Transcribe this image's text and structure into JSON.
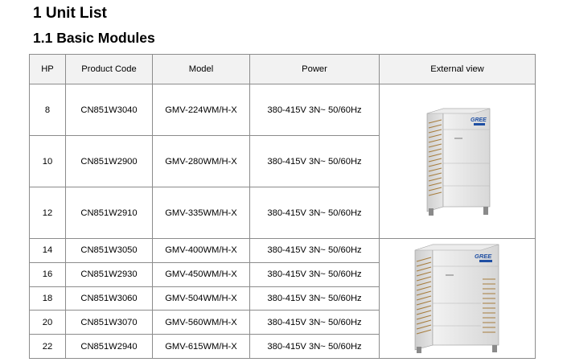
{
  "headings": {
    "h1": "1 Unit List",
    "h2": "1.1 Basic Modules"
  },
  "table": {
    "columns": [
      "HP",
      "Product Code",
      "Model",
      "Power",
      "External view"
    ],
    "rows": [
      {
        "hp": "8",
        "code": "CN851W3040",
        "model": "GMV-224WM/H-X",
        "power": "380-415V 3N~ 50/60Hz"
      },
      {
        "hp": "10",
        "code": "CN851W2900",
        "model": "GMV-280WM/H-X",
        "power": "380-415V 3N~ 50/60Hz"
      },
      {
        "hp": "12",
        "code": "CN851W2910",
        "model": "GMV-335WM/H-X",
        "power": "380-415V 3N~ 50/60Hz"
      },
      {
        "hp": "14",
        "code": "CN851W3050",
        "model": "GMV-400WM/H-X",
        "power": "380-415V 3N~ 50/60Hz"
      },
      {
        "hp": "16",
        "code": "CN851W2930",
        "model": "GMV-450WM/H-X",
        "power": "380-415V 3N~ 50/60Hz"
      },
      {
        "hp": "18",
        "code": "CN851W3060",
        "model": "GMV-504WM/H-X",
        "power": "380-415V 3N~ 50/60Hz"
      },
      {
        "hp": "20",
        "code": "CN851W3070",
        "model": "GMV-560WM/H-X",
        "power": "380-415V 3N~ 50/60Hz"
      },
      {
        "hp": "22",
        "code": "CN851W2940",
        "model": "GMV-615WM/H-X",
        "power": "380-415V 3N~ 50/60Hz"
      }
    ],
    "images": [
      {
        "brand": "GREE"
      },
      {
        "brand": "GREE"
      }
    ]
  }
}
